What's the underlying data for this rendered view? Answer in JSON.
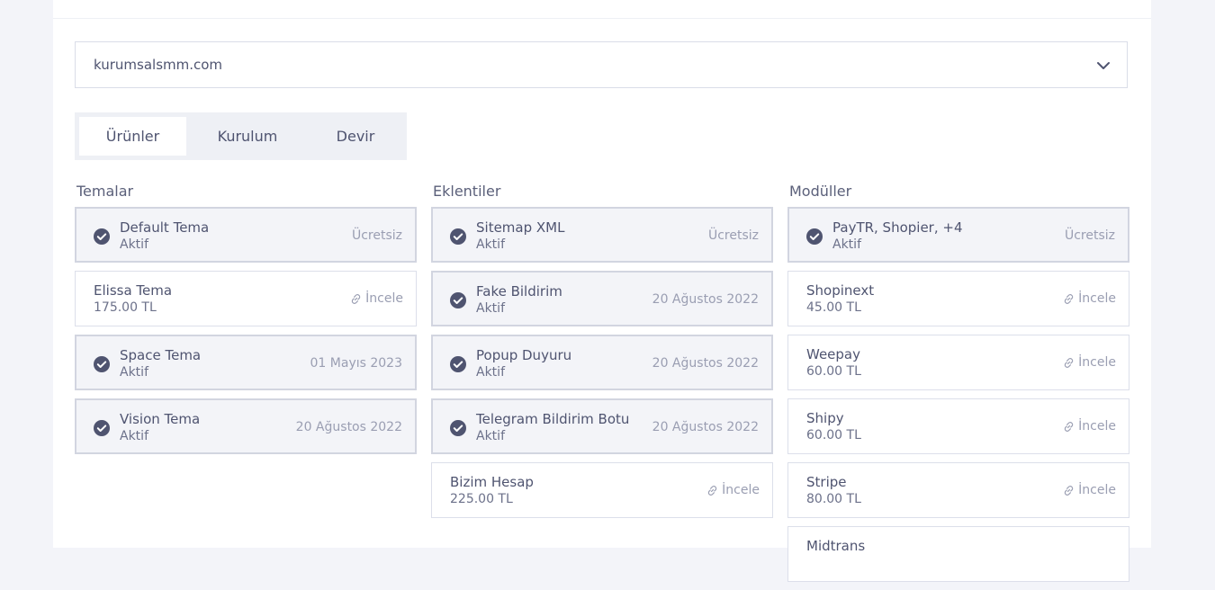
{
  "domain_select": {
    "value": "kurumsalsmm.com"
  },
  "tabs": [
    {
      "label": "Ürünler",
      "active": true
    },
    {
      "label": "Kurulum",
      "active": false
    },
    {
      "label": "Devir",
      "active": false
    }
  ],
  "columns": {
    "temalar": {
      "title": "Temalar",
      "items": [
        {
          "name": "Default Tema",
          "sub": "Aktif",
          "right": "Ücretsiz"
        },
        {
          "name": "Elissa Tema",
          "sub": "175.00 TL",
          "right": "İncele"
        },
        {
          "name": "Space Tema",
          "sub": "Aktif",
          "right": "01 Mayıs 2023"
        },
        {
          "name": "Vision Tema",
          "sub": "Aktif",
          "right": "20 Ağustos 2022"
        }
      ]
    },
    "eklentiler": {
      "title": "Eklentiler",
      "items": [
        {
          "name": "Sitemap XML",
          "sub": "Aktif",
          "right": "Ücretsiz"
        },
        {
          "name": "Fake Bildirim",
          "sub": "Aktif",
          "right": "20 Ağustos 2022"
        },
        {
          "name": "Popup Duyuru",
          "sub": "Aktif",
          "right": "20 Ağustos 2022"
        },
        {
          "name": "Telegram Bildirim Botu",
          "sub": "Aktif",
          "right": "20 Ağustos 2022"
        },
        {
          "name": "Bizim Hesap",
          "sub": "225.00 TL",
          "right": "İncele"
        }
      ]
    },
    "moduller": {
      "title": "Modüller",
      "items": [
        {
          "name": "PayTR, Shopier, +4",
          "sub": "Aktif",
          "right": "Ücretsiz"
        },
        {
          "name": "Shopinext",
          "sub": "45.00 TL",
          "right": "İncele"
        },
        {
          "name": "Weepay",
          "sub": "60.00 TL",
          "right": "İncele"
        },
        {
          "name": "Shipy",
          "sub": "60.00 TL",
          "right": "İncele"
        },
        {
          "name": "Stripe",
          "sub": "80.00 TL",
          "right": "İncele"
        },
        {
          "name": "Midtrans",
          "sub": "",
          "right": ""
        }
      ]
    }
  },
  "colors": {
    "accent": "#4f5470",
    "active_bg": "#f3f4f8",
    "page_bg": "#f3f4f9"
  },
  "icons": {
    "active": "check-circle-icon",
    "link": "link-icon",
    "dropdown": "chevron-down-icon"
  }
}
